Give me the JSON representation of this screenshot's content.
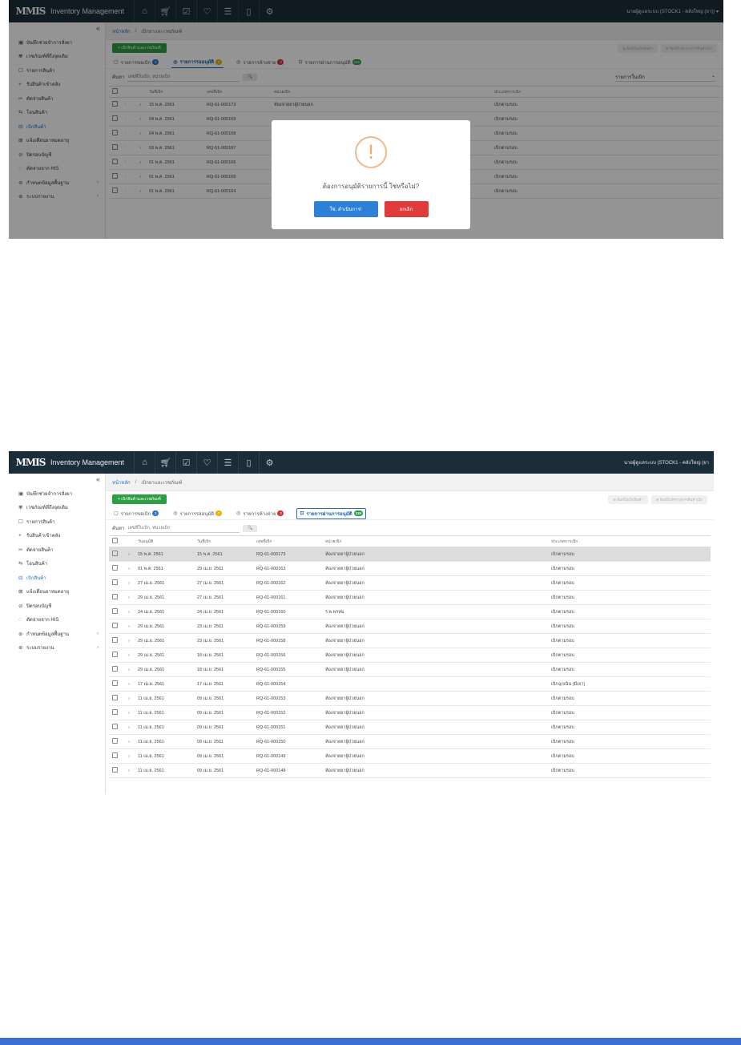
{
  "colors": {
    "topbar": "#1c2d3a",
    "accent": "#1a73c8",
    "green": "#2e9e44",
    "danger": "#e03a3a",
    "footer": "#3d6fd0"
  },
  "topbar": {
    "logo": "MMIS",
    "app_title": "Inventory Management",
    "icons": [
      "home-icon",
      "cart-icon",
      "check-square-icon",
      "heart-pulse-icon",
      "database-icon",
      "document-icon",
      "gear-icon"
    ],
    "user_shot1": "นายผู้ดูแลระบบ (STOCK1 - คลังใหญ่ (ยา)) ▾",
    "user_shot2": "นายผู้ดูแลระบบ (STOCK1 - คลังใหญ่ (ยา"
  },
  "sidebar": {
    "items": [
      {
        "icon": "▣",
        "label": "บันทึกช่วยจำการสั่งยา"
      },
      {
        "icon": "✾",
        "label": "เวชภัณฑ์ที่ถึงจุดเติม"
      },
      {
        "icon": "☐",
        "label": "รายการสินค้า"
      },
      {
        "icon": "+",
        "label": "รับสินค้าเข้าคลัง"
      },
      {
        "icon": "✂",
        "label": "ตัดจ่ายสินค้า"
      },
      {
        "icon": "⇆",
        "label": "โอนสินค้า"
      },
      {
        "icon": "⊟",
        "label": "เบิกสินค้า"
      },
      {
        "icon": "⊠",
        "label": "แจ้งเตือนยาหมดอายุ"
      },
      {
        "icon": "⊘",
        "label": "ปิดรอบบัญชี"
      },
      {
        "icon": "◌",
        "label": "ตัดจ่ายจาก HIS"
      },
      {
        "icon": "⊛",
        "label": "กำหนดข้อมูลพื้นฐาน",
        "chev": "›"
      },
      {
        "icon": "⊕",
        "label": "ระบบรายงาน",
        "chev": "›"
      }
    ]
  },
  "breadcrumb": {
    "home": "หน้าหลัก",
    "sep": "/",
    "current": "เบิกยาและเวชภัณฑ์"
  },
  "toolbar": {
    "new_label": "+ เบิกสินค้าและเวชภัณฑ์",
    "btn_a": "⊕ พิมพ์ใบเบิกสินค้า",
    "btn_b": "⊕ พิมพ์ใบจัดรายการสินค้าเบิก"
  },
  "tabs": [
    {
      "icon": "▢",
      "label": "รายการขอเบิก",
      "badge": "3",
      "badge_color": "#2b74d0"
    },
    {
      "icon": "◎",
      "label": "รายการรออนุมัติ",
      "badge": "7",
      "badge_color": "#e8b400"
    },
    {
      "icon": "◎",
      "label": "รายการค้างจ่าย",
      "badge": "3",
      "badge_color": "#d83030"
    },
    {
      "icon": "⊡",
      "label": "รายการผ่านการอนุมัติ",
      "badge": "119",
      "badge_color": "#2e9e44"
    }
  ],
  "filter": {
    "label": "ค้นหา",
    "placeholder": "เลขที่ใบเบิก, หน่วยเบิก",
    "button": "🔍",
    "select_value": "รายการในเบิก",
    "select_chev": "⌄"
  },
  "table1": {
    "headers": [
      "วันที่เบิก",
      "เลขที่เบิก",
      "หน่วยเบิก",
      "ประเภทการเบิก"
    ],
    "rows": [
      {
        "date": "15 พ.ค. 2561",
        "no": "RQ-61-000173",
        "unit": "ห้องจ่ายยาผู้ป่วยนอก",
        "type": "เบิกตามรอบ"
      },
      {
        "date": "04 พ.ค. 2561",
        "no": "RQ-61-000169",
        "unit": "",
        "type": "เบิกตามรอบ"
      },
      {
        "date": "04 พ.ค. 2561",
        "no": "RQ-61-000168",
        "unit": "",
        "type": "เบิกตามรอบ"
      },
      {
        "date": "03 พ.ค. 2561",
        "no": "RQ-61-000167",
        "unit": "",
        "type": "เบิกตามรอบ"
      },
      {
        "date": "01 พ.ค. 2561",
        "no": "RQ-61-000166",
        "unit": "",
        "type": "เบิกตามรอบ"
      },
      {
        "date": "01 พ.ค. 2561",
        "no": "RQ-61-000165",
        "unit": "",
        "type": "เบิกตามรอบ"
      },
      {
        "date": "01 พ.ค. 2561",
        "no": "RQ-61-000164",
        "unit": "",
        "type": "เบิกตามรอบ"
      }
    ]
  },
  "modal": {
    "icon": "!",
    "message": "ต้องการอนุมัติรายการนี้ ใช่หรือไม่?",
    "ok": "ใช่, ดำเนินการ!",
    "cancel": "ยกเลิก"
  },
  "table2": {
    "headers": [
      "วันอนุมัติ",
      "วันที่เบิก",
      "เลขที่เบิก",
      "หน่วยเบิก",
      "ประเภทการเบิก"
    ],
    "rows": [
      {
        "approve": "15 พ.ค. 2561",
        "date": "15 พ.ค. 2561",
        "no": "RQ-61-000173",
        "unit": "ห้องจ่ายยาผู้ป่วยนอก",
        "type": "เบิกตามรอบ"
      },
      {
        "approve": "01 พ.ค. 2561",
        "date": "29 เม.ย. 2561",
        "no": "RQ-61-000163",
        "unit": "ห้องจ่ายยาผู้ป่วยนอก",
        "type": "เบิกตามรอบ"
      },
      {
        "approve": "27 เม.ย. 2561",
        "date": "27 เม.ย. 2561",
        "no": "RQ-61-000162",
        "unit": "ห้องจ่ายยาผู้ป่วยนอก",
        "type": "เบิกตามรอบ"
      },
      {
        "approve": "29 เม.ย. 2561",
        "date": "27 เม.ย. 2561",
        "no": "RQ-61-000161",
        "unit": "ห้องจ่ายยาผู้ป่วยนอก",
        "type": "เบิกตามรอบ"
      },
      {
        "approve": "24 เม.ย. 2561",
        "date": "24 เม.ย. 2561",
        "no": "RQ-61-000160",
        "unit": "ร.พ.พรหม",
        "type": "เบิกตามรอบ"
      },
      {
        "approve": "29 เม.ย. 2561",
        "date": "23 เม.ย. 2561",
        "no": "RQ-61-000159",
        "unit": "ห้องจ่ายยาผู้ป่วยนอก",
        "type": "เบิกตามรอบ"
      },
      {
        "approve": "29 เม.ย. 2561",
        "date": "23 เม.ย. 2561",
        "no": "RQ-61-000158",
        "unit": "ห้องจ่ายยาผู้ป่วยนอก",
        "type": "เบิกตามรอบ"
      },
      {
        "approve": "29 เม.ย. 2561",
        "date": "18 เม.ย. 2561",
        "no": "RQ-61-000156",
        "unit": "ห้องจ่ายยาผู้ป่วยนอก",
        "type": "เบิกตามรอบ"
      },
      {
        "approve": "29 เม.ย. 2561",
        "date": "18 เม.ย. 2561",
        "no": "RQ-61-000155",
        "unit": "ห้องจ่ายยาผู้ป่วยนอก",
        "type": "เบิกตามรอบ"
      },
      {
        "approve": "17 เม.ย. 2561",
        "date": "17 เม.ย. 2561",
        "no": "RQ-61-000154",
        "unit": "",
        "type": "เบิกฉุกเฉิน (มีเยา)"
      },
      {
        "approve": "11 เม.ย. 2561",
        "date": "09 เม.ย. 2561",
        "no": "RQ-61-000153",
        "unit": "ห้องจ่ายยาผู้ป่วยนอก",
        "type": "เบิกตามรอบ"
      },
      {
        "approve": "11 เม.ย. 2561",
        "date": "09 เม.ย. 2561",
        "no": "RQ-61-000152",
        "unit": "ห้องจ่ายยาผู้ป่วยนอก",
        "type": "เบิกตามรอบ"
      },
      {
        "approve": "11 เม.ย. 2561",
        "date": "09 เม.ย. 2561",
        "no": "RQ-61-000151",
        "unit": "ห้องจ่ายยาผู้ป่วยนอก",
        "type": "เบิกตามรอบ"
      },
      {
        "approve": "11 เม.ย. 2561",
        "date": "09 เม.ย. 2561",
        "no": "RQ-61-000150",
        "unit": "ห้องจ่ายยาผู้ป่วยนอก",
        "type": "เบิกตามรอบ"
      },
      {
        "approve": "11 เม.ย. 2561",
        "date": "09 เม.ย. 2561",
        "no": "RQ-61-000149",
        "unit": "ห้องจ่ายยาผู้ป่วยนอก",
        "type": "เบิกตามรอบ"
      },
      {
        "approve": "11 เม.ย. 2561",
        "date": "09 เม.ย. 2561",
        "no": "RQ-61-000148",
        "unit": "ห้องจ่ายยาผู้ป่วยนอก",
        "type": "เบิกตามรอบ"
      }
    ]
  }
}
